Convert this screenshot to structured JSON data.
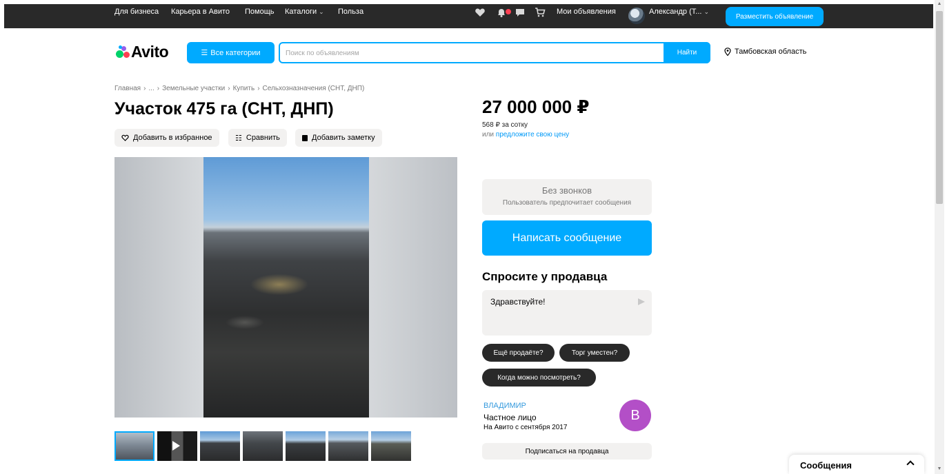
{
  "topbar": {
    "links": [
      "Для бизнеса",
      "Карьера в Авито",
      "Помощь",
      "Каталоги",
      "Польза"
    ],
    "my_ads": "Мои объявления",
    "user_name": "Александр (Т...",
    "post_button": "Разместить объявление"
  },
  "header": {
    "logo_text": "Avito",
    "categories_button": "Все категории",
    "search_placeholder": "Поиск по объявлениям",
    "search_button": "Найти",
    "region": "Тамбовская область"
  },
  "breadcrumb": {
    "items": [
      "Главная",
      "...",
      "Земельные участки",
      "Купить",
      "Сельхозназначения (СНТ, ДНП)"
    ]
  },
  "listing": {
    "title": "Участок 475 га (СНТ, ДНП)",
    "actions": {
      "favorite": "Добавить в избранное",
      "compare": "Сравнить",
      "note": "Добавить заметку"
    },
    "thumbnail_count": 7
  },
  "price": {
    "value": "27 000 000 ₽",
    "per_unit": "568 ₽ за сотку",
    "offer_prefix": "или",
    "offer_link": "предложите свою цену"
  },
  "contact": {
    "no_calls_title": "Без звонков",
    "no_calls_sub": "Пользователь предпочитает сообщения",
    "message_button": "Написать сообщение"
  },
  "ask": {
    "title": "Спросите у продавца",
    "message_text": "Здравствуйте!",
    "quick_replies": [
      "Ещё продаёте?",
      "Торг уместен?",
      "Когда можно посмотреть?"
    ]
  },
  "seller": {
    "name": "Владимир",
    "type": "Частное лицо",
    "since": "На Авито с сентября 2017",
    "avatar_letter": "В",
    "avatar_color": "#b34fc7",
    "subscribe_button": "Подписаться на продавца"
  },
  "messenger": {
    "label": "Сообщения"
  },
  "colors": {
    "accent": "#00aaff",
    "topbar": "#292929",
    "chip": "#292929",
    "soft_bg": "#f2f1f0",
    "link": "#0099f7"
  }
}
